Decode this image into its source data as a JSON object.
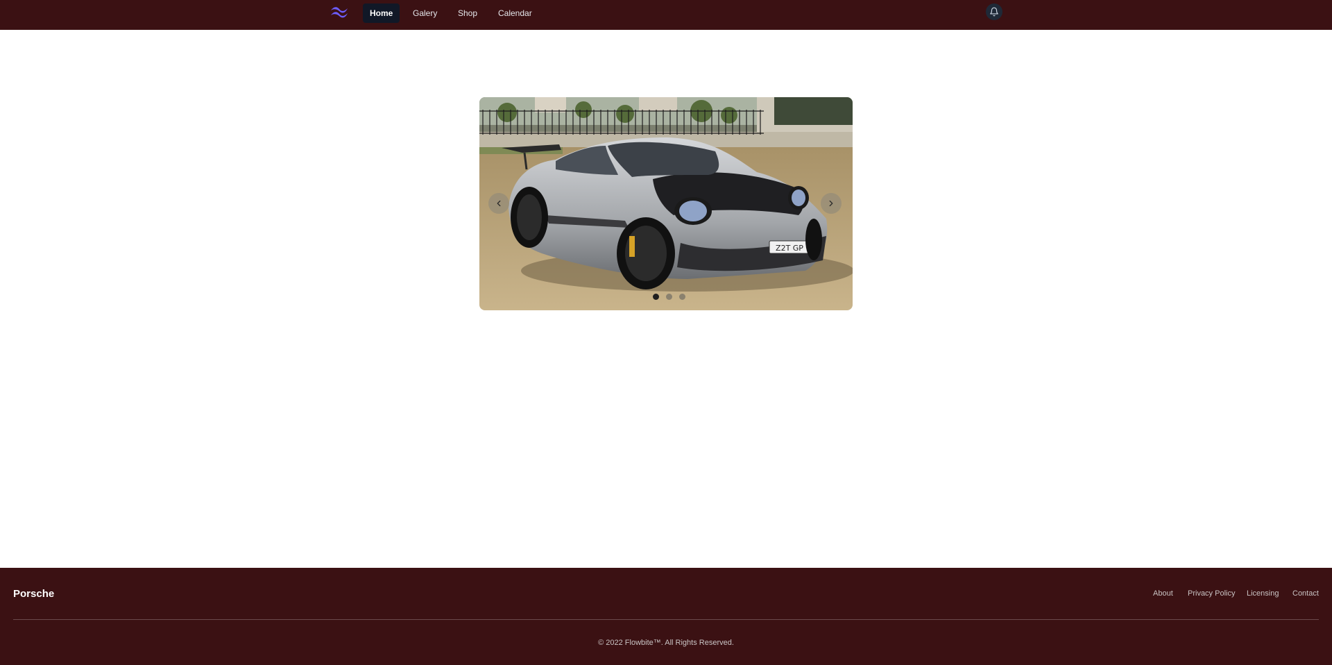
{
  "nav": {
    "logo_icon": "tailwind-wave-logo",
    "links": [
      {
        "label": "Home",
        "active": true
      },
      {
        "label": "Galery",
        "active": false
      },
      {
        "label": "Shop",
        "active": false
      },
      {
        "label": "Calendar",
        "active": false
      }
    ],
    "notification_icon": "bell-icon"
  },
  "carousel": {
    "slide_alt": "Silver Porsche 911 GT3 RS with carbon hood parked on dry grass",
    "plate_text": "Z2T GP",
    "prev_icon": "chevron-left-icon",
    "next_icon": "chevron-right-icon",
    "slide_count": 3,
    "active_slide": 1
  },
  "footer": {
    "brand": "Porsche",
    "links": [
      "About",
      "Privacy Policy",
      "Licensing",
      "Contact"
    ],
    "copyright": "© 2022 Flowbite™. All Rights Reserved."
  },
  "colors": {
    "nav_bg": "#3b1113",
    "footer_bg": "#3b1113",
    "active_link_bg": "#111827",
    "logo_accent": "#6d5dfc"
  }
}
